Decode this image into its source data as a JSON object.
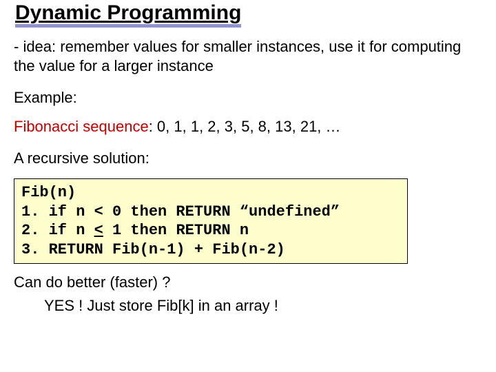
{
  "title": "Dynamic Programming",
  "idea": "- idea: remember values for smaller instances, use it for computing the value for a larger instance",
  "example_label": "Example:",
  "fib": {
    "label": "Fibonacci sequence",
    "values": " 0, 1, 1, 2, 3, 5, 8, 13, 21, …"
  },
  "recursive_label": "A recursive solution:",
  "code": {
    "line0": "Fib(n)",
    "line1": "1. if n < 0 then RETURN “undefined”",
    "line2a": "2. if n ",
    "leq": "<",
    "line2b": " 1 then RETURN n",
    "line3": "3. RETURN Fib(n-1) + Fib(n-2)"
  },
  "question": "Can do better (faster) ?",
  "answer": "YES ! Just store Fib[k] in an array !"
}
